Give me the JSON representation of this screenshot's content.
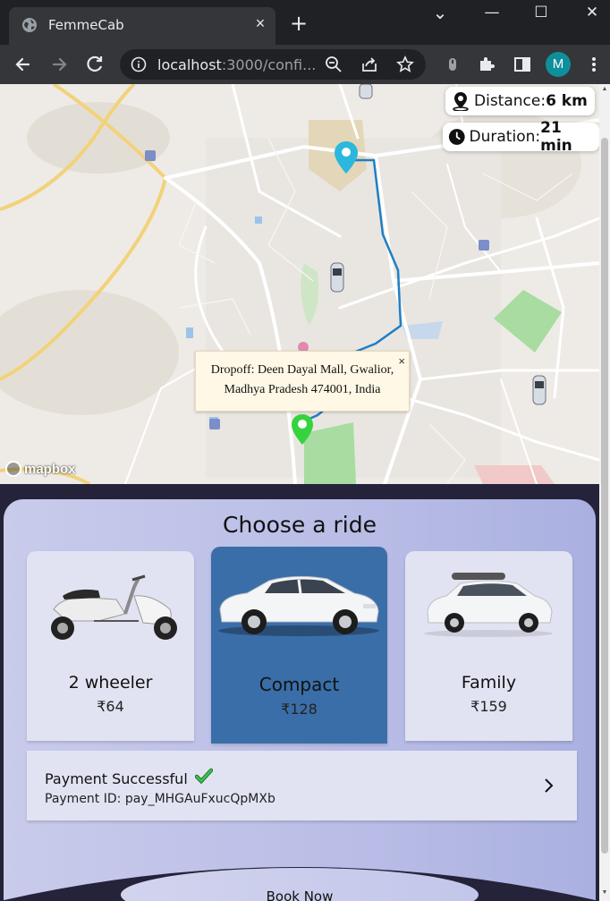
{
  "browser": {
    "tab_title": "FemmeCab",
    "tab_close": "×",
    "new_tab": "+",
    "controls": {
      "dropdown": "⌄",
      "minimize": "—",
      "maximize": "☐",
      "close": "✕"
    },
    "url_host": "localhost",
    "url_rest": ":3000/confi...",
    "profile_initial": "M",
    "icons": [
      "back-arrow-icon",
      "forward-arrow-icon",
      "reload-icon",
      "info-icon",
      "zoom-icon",
      "share-icon",
      "star-icon",
      "extension-puzzle-icon",
      "sidepanel-icon",
      "menu-dots-icon"
    ]
  },
  "map": {
    "distance_label": "Distance:",
    "distance_value": "6 km",
    "duration_label": "Duration:",
    "duration_value": "21 min",
    "popup_line1": "Dropoff: Deen Dayal Mall, Gwalior,",
    "popup_line2": "Madhya Pradesh 474001, India",
    "popup_close": "×",
    "attribution": "mapbox",
    "colors": {
      "route": "#1f7fc4",
      "pickup_pin": "#2bb8dc",
      "dropoff_pin": "#35d33d",
      "park": "#a8dca0"
    }
  },
  "panel": {
    "title": "Choose a ride",
    "rides": [
      {
        "name": "2 wheeler",
        "price": "₹64",
        "icon": "scooter-image"
      },
      {
        "name": "Compact",
        "price": "₹128",
        "icon": "sedan-image",
        "selected": true
      },
      {
        "name": "Family",
        "price": "₹159",
        "icon": "suv-image"
      }
    ],
    "payment_title": "Payment Successful",
    "payment_id": "Payment ID: pay_MHGAuFxucQpMXb",
    "book_label": "Book Now",
    "colors": {
      "selected_card": "#3a6ea8",
      "card": "#e2e3f2",
      "check": "#2ea043"
    }
  }
}
